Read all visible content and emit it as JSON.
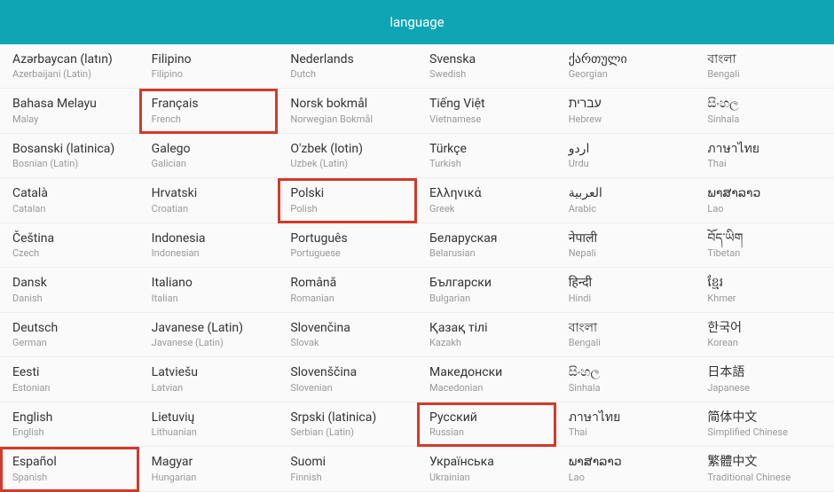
{
  "header": {
    "title": "language"
  },
  "columns": [
    [
      {
        "native": "Azərbaycan (latın)",
        "english": "Azerbaijani (Latin)",
        "hl": false
      },
      {
        "native": "Bahasa Melayu",
        "english": "Malay",
        "hl": false
      },
      {
        "native": "Bosanski (latinica)",
        "english": "Bosnian (Latin)",
        "hl": false
      },
      {
        "native": "Català",
        "english": "Catalan",
        "hl": false
      },
      {
        "native": "Čeština",
        "english": "Czech",
        "hl": false
      },
      {
        "native": "Dansk",
        "english": "Danish",
        "hl": false
      },
      {
        "native": "Deutsch",
        "english": "German",
        "hl": false
      },
      {
        "native": "Eesti",
        "english": "Estonian",
        "hl": false
      },
      {
        "native": "English",
        "english": "English",
        "hl": false
      },
      {
        "native": "Español",
        "english": "Spanish",
        "hl": true
      }
    ],
    [
      {
        "native": "Filipino",
        "english": "Filipino",
        "hl": false
      },
      {
        "native": "Français",
        "english": "French",
        "hl": true
      },
      {
        "native": "Galego",
        "english": "Galician",
        "hl": false
      },
      {
        "native": "Hrvatski",
        "english": "Croatian",
        "hl": false
      },
      {
        "native": "Indonesia",
        "english": "Indonesian",
        "hl": false
      },
      {
        "native": "Italiano",
        "english": "Italian",
        "hl": false
      },
      {
        "native": "Javanese (Latin)",
        "english": "Javanese (Latin)",
        "hl": false
      },
      {
        "native": "Latviešu",
        "english": "Latvian",
        "hl": false
      },
      {
        "native": "Lietuvių",
        "english": "Lithuanian",
        "hl": false
      },
      {
        "native": "Magyar",
        "english": "Hungarian",
        "hl": false
      }
    ],
    [
      {
        "native": "Nederlands",
        "english": "Dutch",
        "hl": false
      },
      {
        "native": "Norsk bokmål",
        "english": "Norwegian Bokmål",
        "hl": false
      },
      {
        "native": "O'zbek (lotin)",
        "english": "Uzbek (Latin)",
        "hl": false
      },
      {
        "native": "Polski",
        "english": "Polish",
        "hl": true
      },
      {
        "native": "Português",
        "english": "Portuguese",
        "hl": false
      },
      {
        "native": "Română",
        "english": "Romanian",
        "hl": false
      },
      {
        "native": "Slovenčina",
        "english": "Slovak",
        "hl": false
      },
      {
        "native": "Slovenščina",
        "english": "Slovenian",
        "hl": false
      },
      {
        "native": "Srpski (latinica)",
        "english": "Serbian (Latin)",
        "hl": false
      },
      {
        "native": "Suomi",
        "english": "Finnish",
        "hl": false
      }
    ],
    [
      {
        "native": "Svenska",
        "english": "Swedish",
        "hl": false
      },
      {
        "native": "Tiếng Việt",
        "english": "Vietnamese",
        "hl": false
      },
      {
        "native": "Türkçe",
        "english": "Turkish",
        "hl": false
      },
      {
        "native": "Ελληνικά",
        "english": "Greek",
        "hl": false
      },
      {
        "native": "Беларуская",
        "english": "Belarusian",
        "hl": false
      },
      {
        "native": "Български",
        "english": "Bulgarian",
        "hl": false
      },
      {
        "native": "Қазақ тілі",
        "english": "Kazakh",
        "hl": false
      },
      {
        "native": "Македонски",
        "english": "Macedonian",
        "hl": false
      },
      {
        "native": "Русский",
        "english": "Russian",
        "hl": true
      },
      {
        "native": "Українська",
        "english": "Ukrainian",
        "hl": false
      }
    ],
    [
      {
        "native": "ქართული",
        "english": "Georgian",
        "hl": false
      },
      {
        "native": "עברית",
        "english": "Hebrew",
        "hl": false
      },
      {
        "native": "اردو",
        "english": "Urdu",
        "hl": false
      },
      {
        "native": "العربية",
        "english": "Arabic",
        "hl": false
      },
      {
        "native": "नेपाली",
        "english": "Nepali",
        "hl": false
      },
      {
        "native": "हिन्दी",
        "english": "Hindi",
        "hl": false
      },
      {
        "native": "বাংলা",
        "english": "Bengali",
        "hl": false
      },
      {
        "native": "සිංහල",
        "english": "Sinhala",
        "hl": false
      },
      {
        "native": "ภาษาไทย",
        "english": "Thai",
        "hl": false
      },
      {
        "native": "ພາສາລາວ",
        "english": "Lao",
        "hl": false
      }
    ],
    [
      {
        "native": "বাংলা",
        "english": "Bengali",
        "hl": false
      },
      {
        "native": "සිංහල",
        "english": "Sinhala",
        "hl": false
      },
      {
        "native": "ภาษาไทย",
        "english": "Thai",
        "hl": false
      },
      {
        "native": "ພາສາລາວ",
        "english": "Lao",
        "hl": false
      },
      {
        "native": "བོད་ཡིག",
        "english": "Tibetan",
        "hl": false
      },
      {
        "native": "ខ្មែរ",
        "english": "Khmer",
        "hl": false
      },
      {
        "native": "한국어",
        "english": "Korean",
        "hl": false
      },
      {
        "native": "日本語",
        "english": "Japanese",
        "hl": false
      },
      {
        "native": "简体中文",
        "english": "Simplified Chinese",
        "hl": false
      },
      {
        "native": "繁體中文",
        "english": "Traditional Chinese",
        "hl": false
      }
    ]
  ]
}
